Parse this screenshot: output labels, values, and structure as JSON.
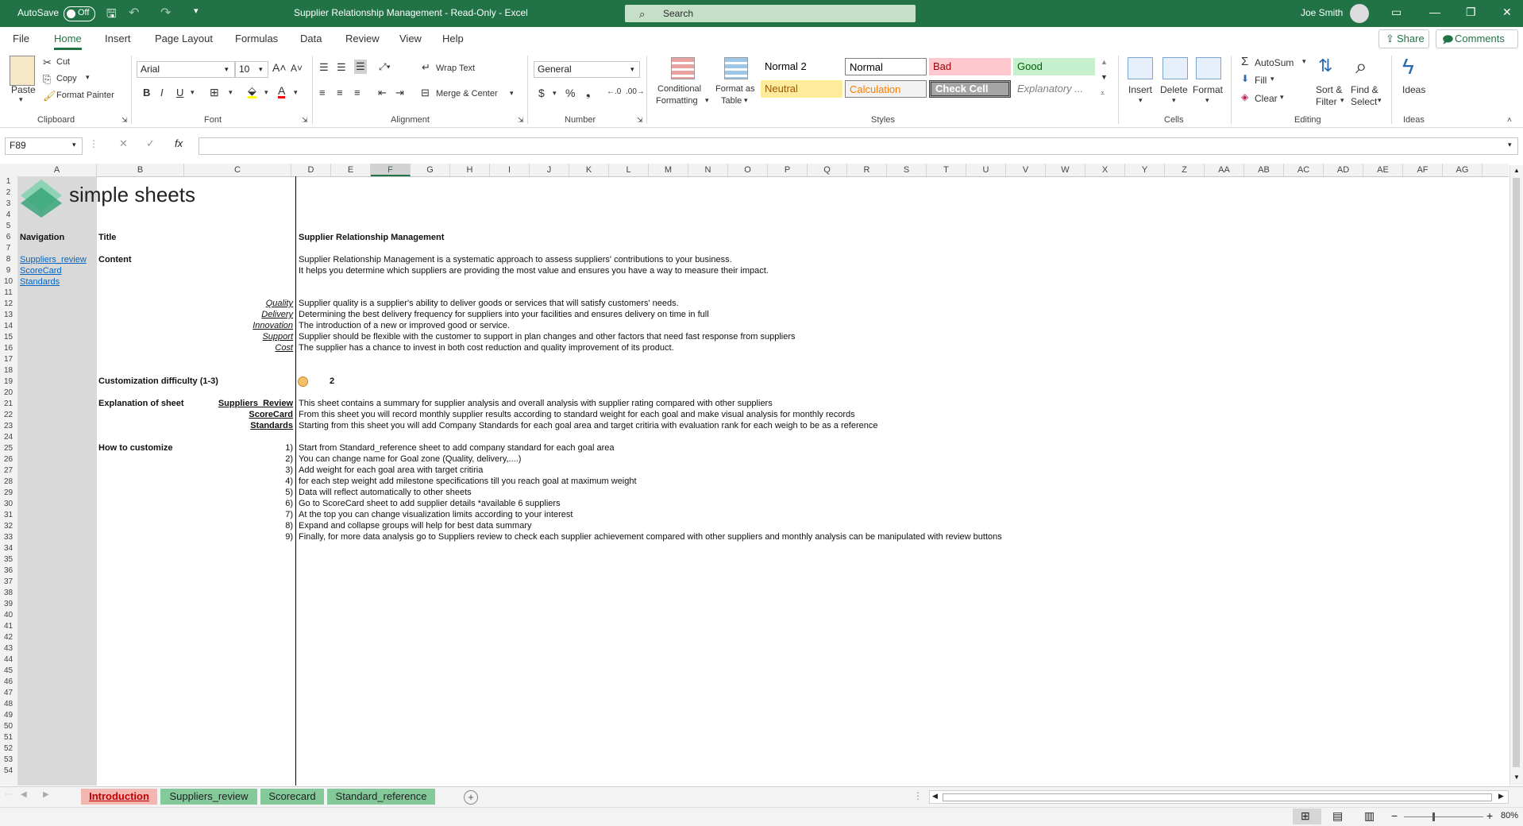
{
  "titlebar": {
    "autosave_label": "AutoSave",
    "autosave_state": "Off",
    "title": "Supplier Relationship Management  -  Read-Only  -  Excel",
    "search_placeholder": "Search",
    "user_name": "Joe Smith"
  },
  "menu": {
    "items": [
      "File",
      "Home",
      "Insert",
      "Page Layout",
      "Formulas",
      "Data",
      "Review",
      "View",
      "Help"
    ],
    "active": "Home",
    "share": "Share",
    "comments": "Comments"
  },
  "ribbon": {
    "clipboard": {
      "label": "Clipboard",
      "paste": "Paste",
      "cut": "Cut",
      "copy": "Copy",
      "format_painter": "Format Painter"
    },
    "font": {
      "label": "Font",
      "family": "Arial",
      "size": "10"
    },
    "alignment": {
      "label": "Alignment",
      "wrap": "Wrap Text",
      "merge": "Merge & Center"
    },
    "number": {
      "label": "Number",
      "format": "General"
    },
    "styles": {
      "label": "Styles",
      "conditional": [
        "Conditional",
        "Formatting"
      ],
      "format_table": [
        "Format as",
        "Table"
      ],
      "cells": [
        {
          "name": "Normal 2",
          "bg": "#ffffff",
          "fg": "#000000"
        },
        {
          "name": "Normal",
          "bg": "#ffffff",
          "fg": "#000000"
        },
        {
          "name": "Bad",
          "bg": "#ffc7ce",
          "fg": "#9c0006"
        },
        {
          "name": "Good",
          "bg": "#c6efce",
          "fg": "#006100"
        },
        {
          "name": "Neutral",
          "bg": "#ffeb9c",
          "fg": "#9c5700"
        },
        {
          "name": "Calculation",
          "bg": "#f2f2f2",
          "fg": "#fa7d00"
        },
        {
          "name": "Check Cell",
          "bg": "#a5a5a5",
          "fg": "#ffffff"
        },
        {
          "name": "Explanatory ...",
          "bg": "#ffffff",
          "fg": "#7f7f7f"
        }
      ]
    },
    "cells": {
      "label": "Cells",
      "insert": "Insert",
      "delete": "Delete",
      "format": "Format"
    },
    "editing": {
      "label": "Editing",
      "autosum": "AutoSum",
      "fill": "Fill",
      "clear": "Clear",
      "sort": [
        "Sort &",
        "Filter"
      ],
      "find": [
        "Find &",
        "Select"
      ]
    },
    "ideas": {
      "label": "Ideas",
      "btn": "Ideas"
    }
  },
  "formula_bar": {
    "name_box": "F89",
    "formula": ""
  },
  "grid": {
    "columns": [
      "A",
      "B",
      "C",
      "D",
      "E",
      "F",
      "G",
      "H",
      "I",
      "J",
      "K",
      "L",
      "M",
      "N",
      "O",
      "P",
      "Q",
      "R",
      "S",
      "T",
      "U",
      "V",
      "W",
      "X",
      "Y",
      "Z",
      "AA",
      "AB",
      "AC",
      "AD",
      "AE",
      "AF",
      "AG"
    ],
    "selected_column": "F",
    "row_count": 54,
    "logo_text": "simple sheets",
    "navigation": {
      "header": "Navigation",
      "links": [
        "Suppliers_review",
        "ScoreCard",
        "Standards"
      ]
    },
    "title_label": "Title",
    "title_value": "Supplier Relationship Management",
    "content_label": "Content",
    "content_lines": [
      "Supplier Relationship Management is a systematic approach to assess suppliers' contributions to your business.",
      "It helps you determine which suppliers are providing the most value and ensures you have a way to measure their impact."
    ],
    "definitions": [
      {
        "term": "Quality",
        "text": "Supplier quality is a supplier's ability to deliver goods or services that will satisfy customers' needs."
      },
      {
        "term": "Delivery",
        "text": "Determining the best delivery frequency for suppliers into your facilities and ensures delivery on time in full"
      },
      {
        "term": "Innovation",
        "text": "The introduction of a new or improved good or service."
      },
      {
        "term": "Support",
        "text": "Supplier should be flexible with the customer to support in plan changes and other factors that need fast response from suppliers"
      },
      {
        "term": "Cost",
        "text": "The supplier has a chance to invest in both cost reduction and quality improvement of its product."
      }
    ],
    "difficulty_label": "Customization difficulty (1-3)",
    "difficulty_value": "2",
    "explanation_label": "Explanation of sheet",
    "explanations": [
      {
        "sheet": "Suppliers_Review",
        "text": "This sheet contains a summary for supplier analysis and overall analysis with supplier rating compared with other suppliers"
      },
      {
        "sheet": "ScoreCard",
        "text": "From this sheet you will record monthly supplier results according to standard weight for each goal and make visual analysis for monthly records"
      },
      {
        "sheet": "Standards",
        "text": "Starting from this sheet you will add Company Standards for each goal area and target critiria with evaluation rank for each weigh to be as a reference"
      }
    ],
    "customize_label": "How to customize",
    "steps": [
      {
        "n": "1)",
        "text": "Start from Standard_reference sheet to add company standard for each goal area"
      },
      {
        "n": "2)",
        "text": "You can change name for Goal zone (Quality, delivery,....)"
      },
      {
        "n": "3)",
        "text": "Add weight for each goal area with target critiria"
      },
      {
        "n": "4)",
        "text": "for each step weight add milestone specifications till you reach goal at maximum weight"
      },
      {
        "n": "5)",
        "text": "Data will reflect automatically to other sheets"
      },
      {
        "n": "6)",
        "text": "Go to ScoreCard sheet to add supplier details *available 6 suppliers"
      },
      {
        "n": "7)",
        "text": "At the top you can change visualization limits according to your interest"
      },
      {
        "n": "8)",
        "text": "Expand and collapse groups will help for best data summary"
      },
      {
        "n": "9)",
        "text": "Finally, for more data analysis go to Suppliers review to check each supplier achievement compared with other suppliers and monthly analysis can be manipulated with review buttons"
      }
    ]
  },
  "sheet_tabs": [
    {
      "name": "Introduction",
      "active": true,
      "bg": "#f4b6b0",
      "fg": "#c00000"
    },
    {
      "name": "Suppliers_review",
      "active": false,
      "bg": "#84c99a",
      "fg": "#1f1f1f"
    },
    {
      "name": "Scorecard",
      "active": false,
      "bg": "#84c99a",
      "fg": "#1f1f1f"
    },
    {
      "name": "Standard_reference",
      "active": false,
      "bg": "#84c99a",
      "fg": "#1f1f1f"
    }
  ],
  "status": {
    "zoom": "80%"
  },
  "colors": {
    "excel_green": "#217346",
    "nav_gray": "#d9d9d9",
    "logo_green": "#3aa57a"
  }
}
